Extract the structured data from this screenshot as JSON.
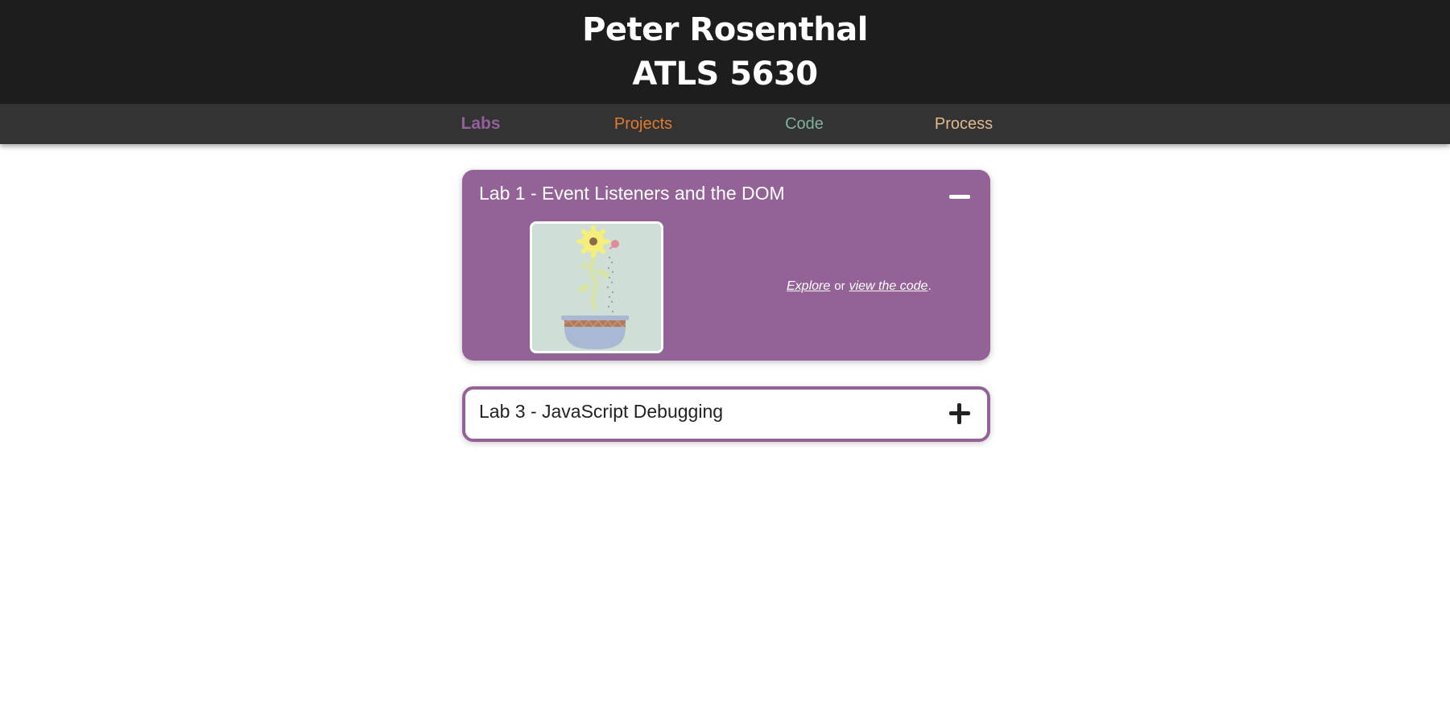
{
  "header": {
    "name": "Peter Rosenthal",
    "course": "ATLS 5630"
  },
  "nav": {
    "items": [
      {
        "label": "Labs",
        "color": "#93619a",
        "active": true
      },
      {
        "label": "Projects",
        "color": "#e07a2f"
      },
      {
        "label": "Code",
        "color": "#7fb29c"
      },
      {
        "label": "Process",
        "color": "#e3b98e"
      }
    ]
  },
  "labs": [
    {
      "title": "Lab 1 - Event Listeners and the DOM",
      "expanded": true,
      "toggle_icon": "minus-icon",
      "thumbnail": "sunflower-pot-image",
      "links": {
        "explore_label": "Explore",
        "separator": "or",
        "code_label": "view the code",
        "end": "."
      }
    },
    {
      "title": "Lab 3 - JavaScript Debugging",
      "expanded": false,
      "toggle_icon": "plus-icon"
    }
  ],
  "colors": {
    "accent": "#936296",
    "header_bg": "#1d1d1d",
    "nav_bg": "#333333"
  }
}
